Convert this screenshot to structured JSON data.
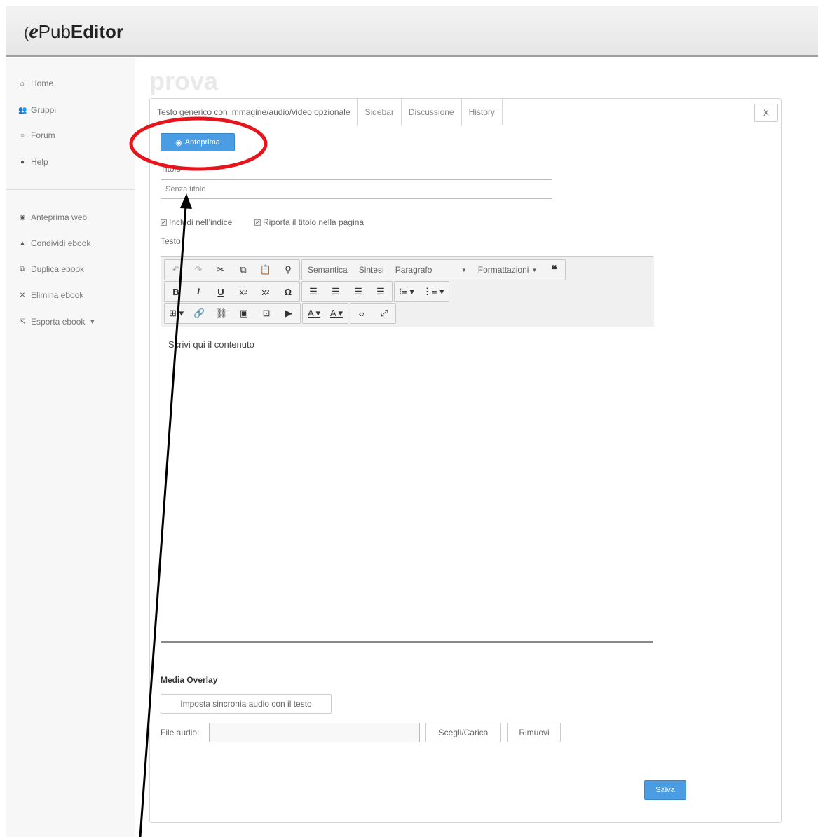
{
  "app": {
    "logo_prefix": "e",
    "logo_mid": "Pub",
    "logo_bold": "Editor"
  },
  "sidebar": {
    "items": [
      {
        "label": "Home",
        "icon": "home-icon"
      },
      {
        "label": "Gruppi",
        "icon": "users-icon"
      },
      {
        "label": "Forum",
        "icon": "chat-icon"
      },
      {
        "label": "Help",
        "icon": "help-icon"
      },
      {
        "label": "Anteprima web",
        "icon": "eye-icon"
      },
      {
        "label": "Condividi ebook",
        "icon": "user-icon"
      },
      {
        "label": "Duplica ebook",
        "icon": "copy-icon"
      },
      {
        "label": "Elimina ebook",
        "icon": "close-icon"
      },
      {
        "label": "Esporta ebook",
        "icon": "export-icon"
      }
    ]
  },
  "page": {
    "title": "prova"
  },
  "tabs": [
    "Testo generico con immagine/audio/video opzionale",
    "Sidebar",
    "Discussione",
    "History"
  ],
  "close_label": "X",
  "preview_button": "Anteprima",
  "form": {
    "title_label": "Titolo",
    "title_value": "Senza titolo",
    "include_index": "Includi nell'indice",
    "show_title": "Riporta il titolo nella pagina",
    "text_label": "Testo"
  },
  "toolbar": {
    "semantica": "Semantica",
    "sintesi": "Sintesi",
    "paragrafo": "Paragrafo",
    "formattazioni": "Formattazioni",
    "bold": "B",
    "italic": "I",
    "underline": "U",
    "omega": "Ω"
  },
  "editor": {
    "content": "Scrivi qui il contenuto"
  },
  "media": {
    "title": "Media Overlay",
    "sync_button": "Imposta sincronia audio con il testo",
    "file_label": "File audio:",
    "choose_button": "Scegli/Carica",
    "remove_button": "Rimuovi"
  },
  "save_button": "Salva",
  "colors": {
    "accent": "#4a9de3",
    "annotation_red": "#e8141c"
  }
}
